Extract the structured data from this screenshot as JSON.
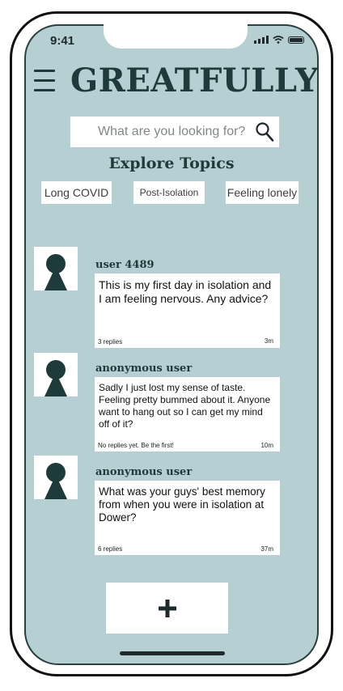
{
  "status_bar": {
    "time": "9:41"
  },
  "header": {
    "brand": "GREATFULLY"
  },
  "search": {
    "placeholder": "What are you looking for?"
  },
  "explore": {
    "title": "Explore Topics",
    "topics": [
      "Long COVID",
      "Post-Isolation",
      "Feeling lonely"
    ]
  },
  "posts": [
    {
      "user": "user 4489",
      "text": "This is my first day in isolation and I am feeling nervous. Any advice?",
      "replies": "3 replies",
      "time": "3m"
    },
    {
      "user": "anonymous user",
      "text": "Sadly I just lost my sense of taste. Feeling pretty bummed about it. Anyone want to hang out so I can get my mind off of it?",
      "replies": "No replies yet. Be the first!",
      "time": "10m"
    },
    {
      "user": "anonymous user",
      "text": "What was your guys' best memory from when you were in isolation at Dower?",
      "replies": "6 replies",
      "time": "37m"
    }
  ],
  "fab": {
    "label": "+"
  },
  "colors": {
    "background": "#b5cfd2",
    "accent": "#1e3a3a",
    "card": "#ffffff"
  },
  "icons": [
    "menu-icon",
    "search-icon",
    "avatar-icon",
    "plus-icon",
    "signal-icon",
    "wifi-icon",
    "battery-icon"
  ]
}
